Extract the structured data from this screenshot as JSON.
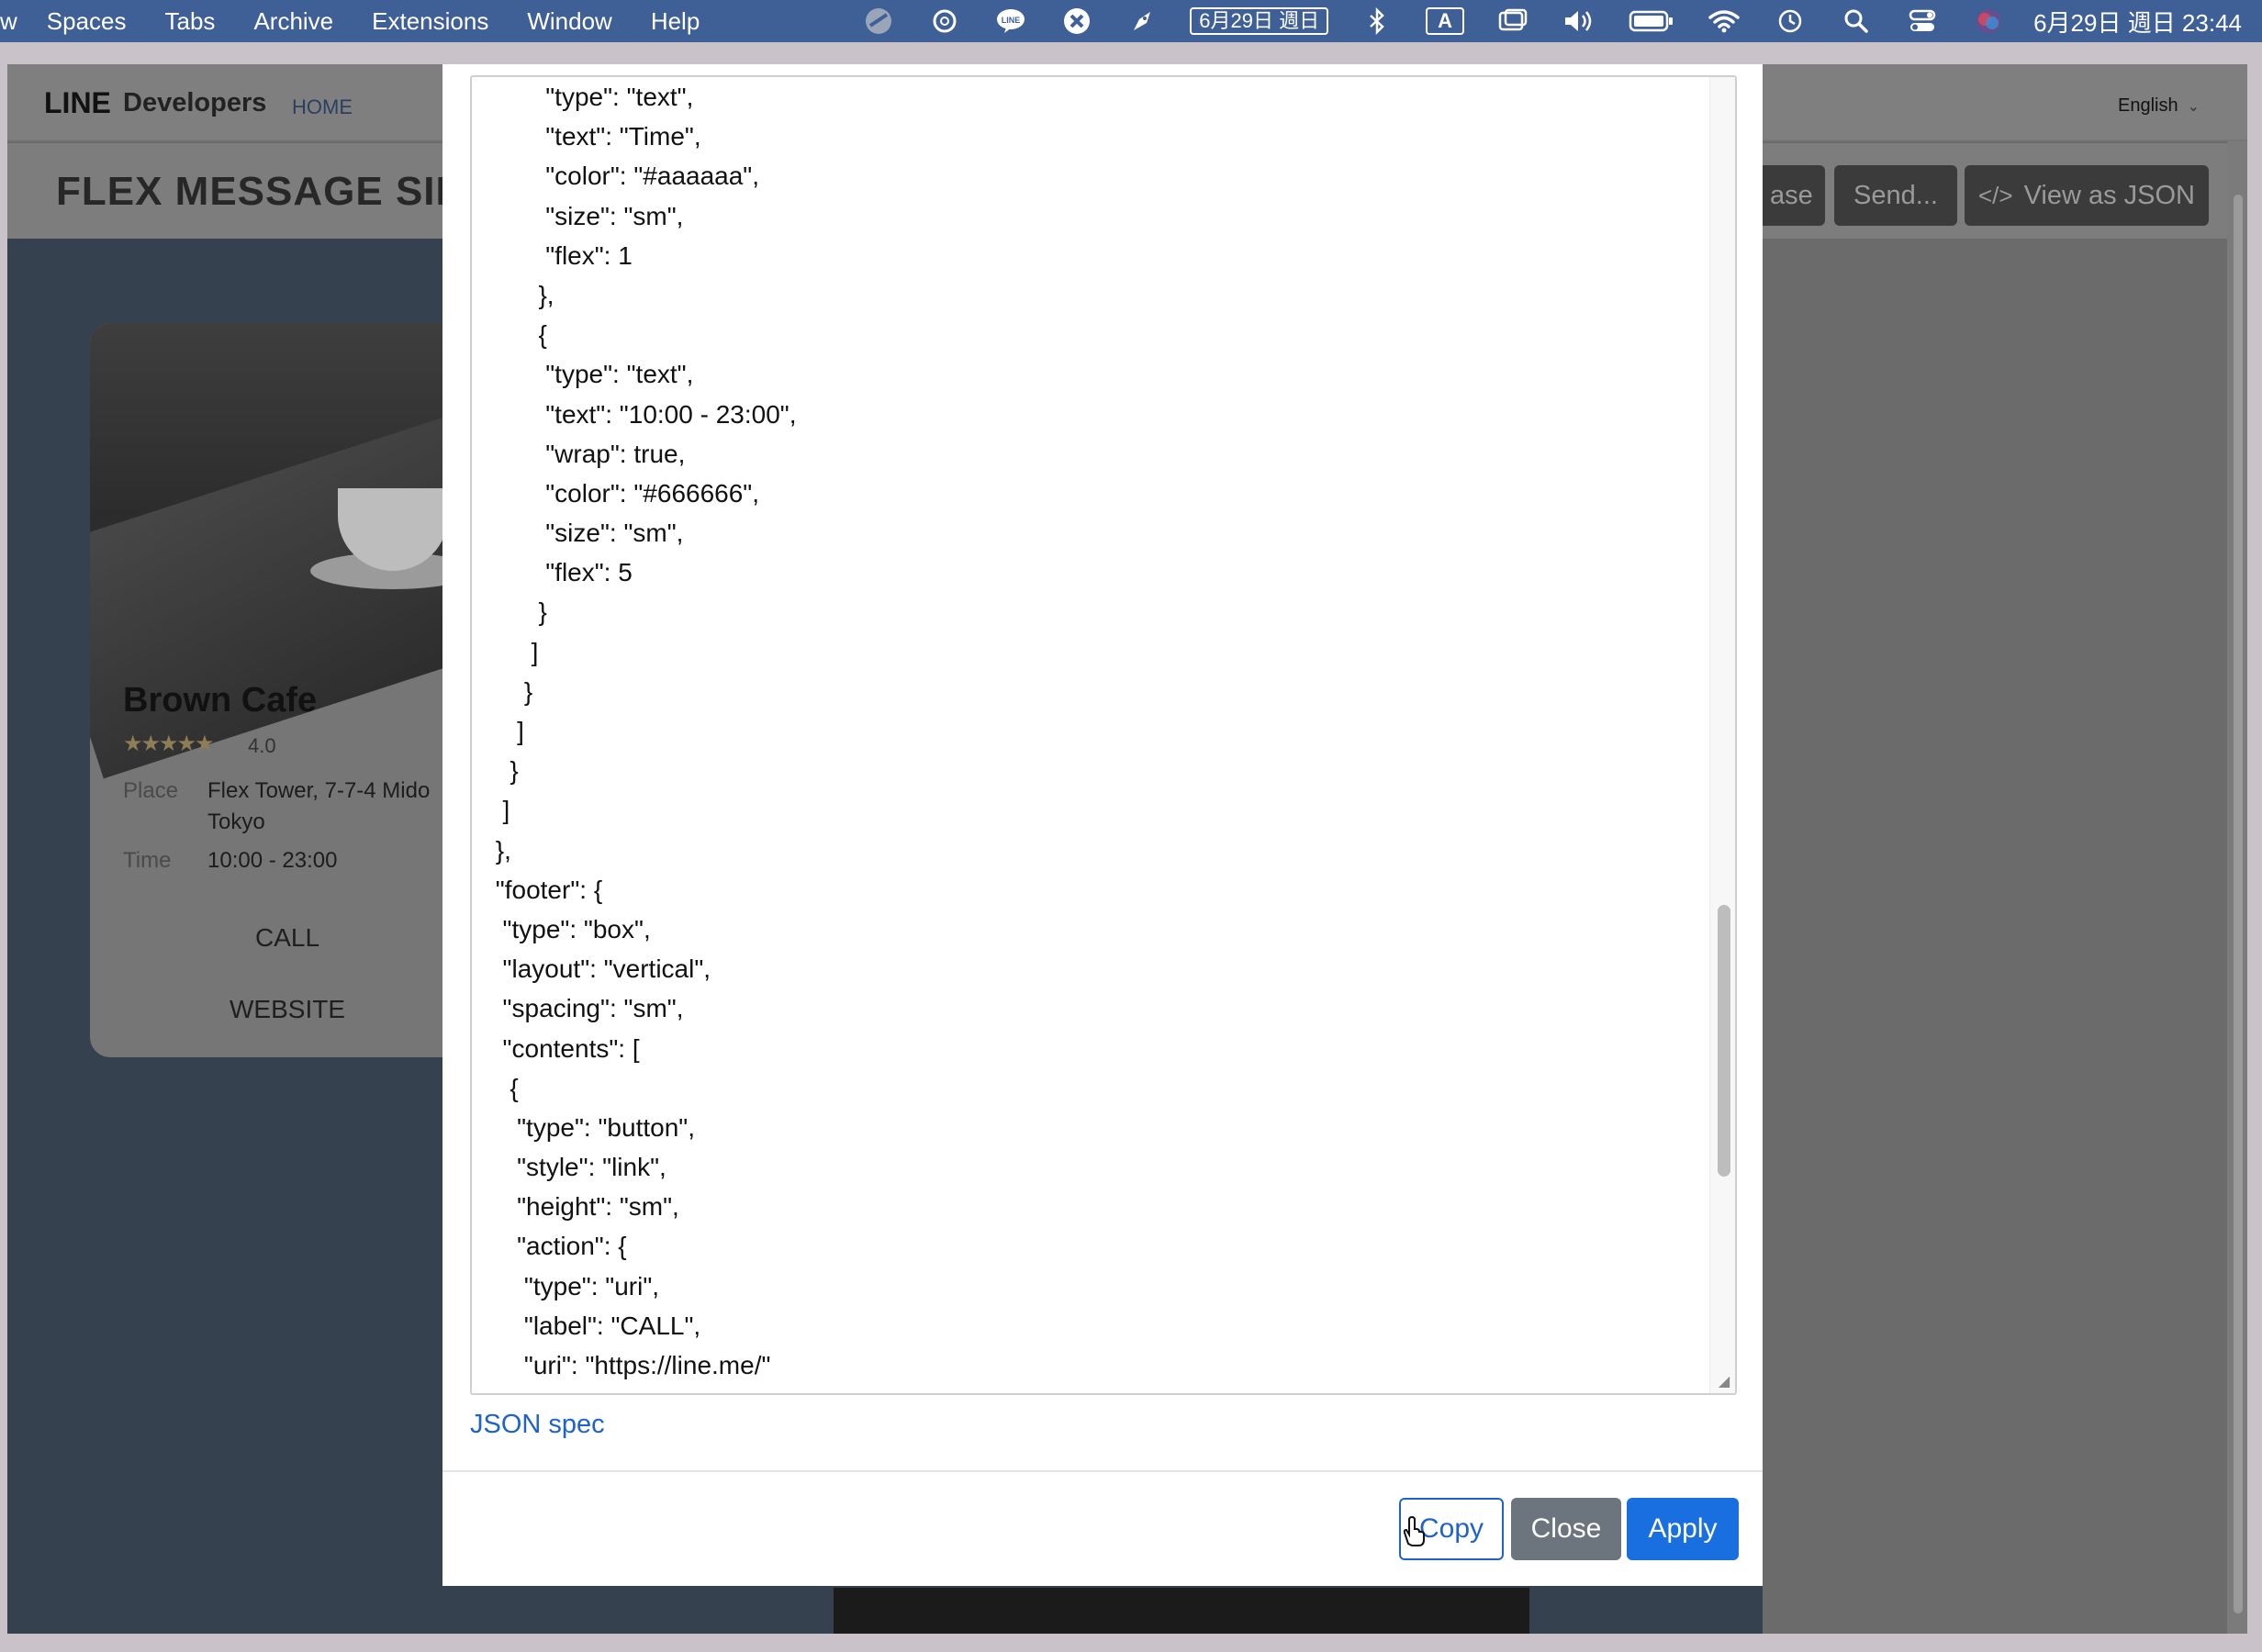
{
  "menubar": {
    "app_menu": "w",
    "menus": [
      "Spaces",
      "Tabs",
      "Archive",
      "Extensions",
      "Window",
      "Help"
    ],
    "status_icons": [
      "screen-share-icon",
      "chatgpt-icon",
      "line-app-icon",
      "x-app-icon",
      "rocket-icon"
    ],
    "date_badge": "6月29日 週日",
    "status_icons_2": [
      "bluetooth-icon",
      "input-source-icon",
      "display-icon",
      "volume-icon",
      "battery-icon",
      "wifi-icon",
      "time-machine-icon",
      "search-icon",
      "control-center-icon",
      "siri-icon"
    ],
    "input_source": "A",
    "clock": "6月29日 週日 23:44"
  },
  "page": {
    "logo_line": "LINE",
    "logo_dev": "Developers",
    "nav_home": "HOME",
    "language": "English",
    "title": "FLEX MESSAGE SIM",
    "toolbar": {
      "release": "ase",
      "send": "Send...",
      "view_json": "View as JSON",
      "view_json_icon": "</>"
    }
  },
  "card": {
    "title": "Brown Cafe",
    "stars": "★★★★★",
    "rating": "4.0",
    "place_key": "Place",
    "place_value_1": "Flex Tower, 7-7-4 Mido",
    "place_value_2": "Tokyo",
    "time_key": "Time",
    "time_value": "10:00 - 23:00",
    "call": "CALL",
    "website": "WEBSITE"
  },
  "modal": {
    "json_lines": [
      "        \"type\": \"text\",",
      "        \"text\": \"Time\",",
      "        \"color\": \"#aaaaaa\",",
      "        \"size\": \"sm\",",
      "        \"flex\": 1",
      "       },",
      "       {",
      "        \"type\": \"text\",",
      "        \"text\": \"10:00 - 23:00\",",
      "        \"wrap\": true,",
      "        \"color\": \"#666666\",",
      "        \"size\": \"sm\",",
      "        \"flex\": 5",
      "       }",
      "      ]",
      "     }",
      "    ]",
      "   }",
      "  ]",
      " },",
      " \"footer\": {",
      "  \"type\": \"box\",",
      "  \"layout\": \"vertical\",",
      "  \"spacing\": \"sm\",",
      "  \"contents\": [",
      "   {",
      "    \"type\": \"button\",",
      "    \"style\": \"link\",",
      "    \"height\": \"sm\",",
      "    \"action\": {",
      "     \"type\": \"uri\",",
      "     \"label\": \"CALL\",",
      "     \"uri\": \"https://line.me/\"",
      "    }"
    ],
    "json_spec_link": "JSON spec",
    "copy": "Copy",
    "close": "Close",
    "apply": "Apply"
  },
  "colors": {
    "menubar": "#3f5f97",
    "primary": "#1a6fe0",
    "secondary": "#6c757d",
    "link": "#1e63c9"
  }
}
